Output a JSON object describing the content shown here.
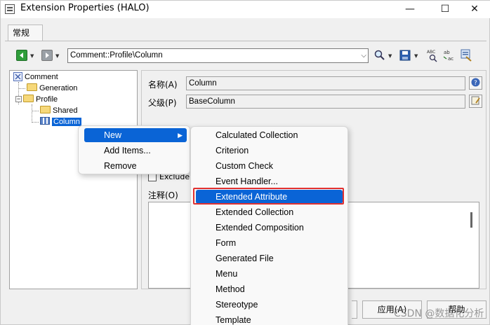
{
  "window": {
    "title": "Extension Properties (HALO)",
    "minimize": "—",
    "maximize": "☐",
    "close": "✕"
  },
  "tabs": [
    {
      "label": "常规"
    }
  ],
  "toolbar": {
    "path": "Comment::Profile\\Column"
  },
  "tree": {
    "root": "Comment",
    "generation": "Generation",
    "profile": "Profile",
    "shared": "Shared",
    "column": "Column"
  },
  "fields": {
    "name_label": "名称(A)",
    "name_value": "Column",
    "parent_label": "父级(P)",
    "parent_value": "BaseColumn",
    "exclude_label": "Exclude",
    "comment_label": "注释(O)"
  },
  "buttons": {
    "apply": "应用(A)",
    "help": "帮助"
  },
  "context_menu": {
    "items": [
      "New",
      "Add Items...",
      "Remove"
    ]
  },
  "submenu": {
    "items": [
      "Calculated Collection",
      "Criterion",
      "Custom Check",
      "Event Handler...",
      "Extended Attribute",
      "Extended Collection",
      "Extended Composition",
      "Form",
      "Generated File",
      "Menu",
      "Method",
      "Stereotype",
      "Template"
    ]
  },
  "watermark": "CSDN @数据化分析"
}
